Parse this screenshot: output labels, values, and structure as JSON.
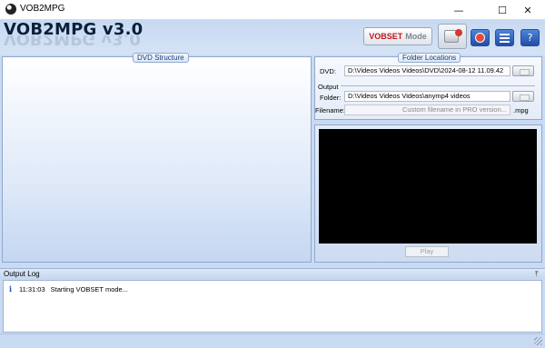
{
  "window": {
    "title": "VOB2MPG"
  },
  "header": {
    "logo": "VOB2MPG v3.0",
    "vobset_red": "VOBSET",
    "vobset_grey": "Mode"
  },
  "dvd_structure": {
    "title": "DVD Structure"
  },
  "folder_locations": {
    "title": "Folder Locations",
    "dvd_label": "DVD:",
    "dvd_path": "D:\\Videos Videos Videos\\DVD\\2024-08-12 11.09.42",
    "output_label": "Output",
    "folder_label": "Folder:",
    "output_path": "D:\\Videos Videos Videos\\anymp4 videos",
    "filename_label": "Filename:",
    "filename_placeholder": "Custom filename in PRO version...",
    "extension": ".mpg"
  },
  "player": {
    "play_label": "Play"
  },
  "output_log": {
    "title": "Output Log",
    "entries": [
      {
        "time": "11:31:03",
        "message": "Starting VOBSET mode..."
      }
    ]
  },
  "icons": {
    "app": "vob2mpg-logo-icon",
    "minimize": "minimize-icon",
    "maximize": "maximize-icon",
    "close": "close-icon",
    "disc": "disc-tool-icon",
    "stop": "stop-icon",
    "list": "list-icon",
    "help": "help-icon",
    "pin": "pin-icon",
    "info": "info-icon"
  }
}
